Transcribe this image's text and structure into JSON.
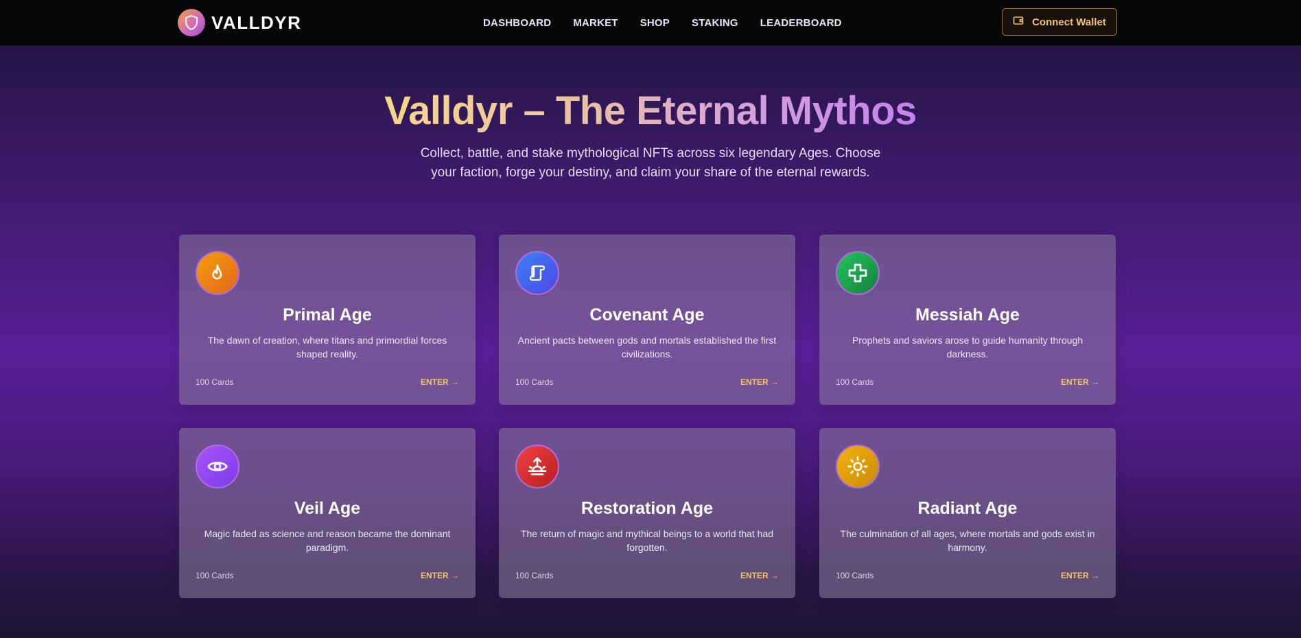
{
  "nav": {
    "brand": "VALLDYR",
    "brand_icon": "shield-icon",
    "links": [
      "DASHBOARD",
      "MARKET",
      "SHOP",
      "STAKING",
      "LEADERBOARD"
    ],
    "wallet_button": "Connect Wallet",
    "wallet_icon": "wallet-icon"
  },
  "hero": {
    "title": "Valldyr – The Eternal Mythos",
    "subtitle": "Collect, battle, and stake mythological NFTs across six legendary Ages. Choose your faction, forge your destiny, and claim your share of the eternal rewards."
  },
  "ages": [
    {
      "title": "Primal Age",
      "description": "The dawn of creation, where titans and primordial forces shaped reality.",
      "count": "100 Cards",
      "enter": "ENTER →",
      "icon": "flame-icon",
      "color": "#f59e0b"
    },
    {
      "title": "Covenant Age",
      "description": "Ancient pacts between gods and mortals established the first civilizations.",
      "count": "100 Cards",
      "enter": "ENTER →",
      "icon": "scroll-icon",
      "color": "#3b82f6"
    },
    {
      "title": "Messiah Age",
      "description": "Prophets and saviors arose to guide humanity through darkness.",
      "count": "100 Cards",
      "enter": "ENTER →",
      "icon": "plus-icon",
      "color": "#22c55e"
    },
    {
      "title": "Veil Age",
      "description": "Magic faded as science and reason became the dominant paradigm.",
      "count": "100 Cards",
      "enter": "ENTER →",
      "icon": "eye-icon",
      "color": "#a855f7"
    },
    {
      "title": "Restoration Age",
      "description": "The return of magic and mythical beings to a world that had forgotten.",
      "count": "100 Cards",
      "enter": "ENTER →",
      "icon": "sunrise-icon",
      "color": "#ef4444"
    },
    {
      "title": "Radiant Age",
      "description": "The culmination of all ages, where mortals and gods exist in harmony.",
      "count": "100 Cards",
      "enter": "ENTER →",
      "icon": "sun-icon",
      "color": "#f5b20b"
    }
  ],
  "colors": {
    "accent_gold": "#f2c466",
    "nav_bg": "#070709",
    "card_border_accent": "#b46be0"
  }
}
